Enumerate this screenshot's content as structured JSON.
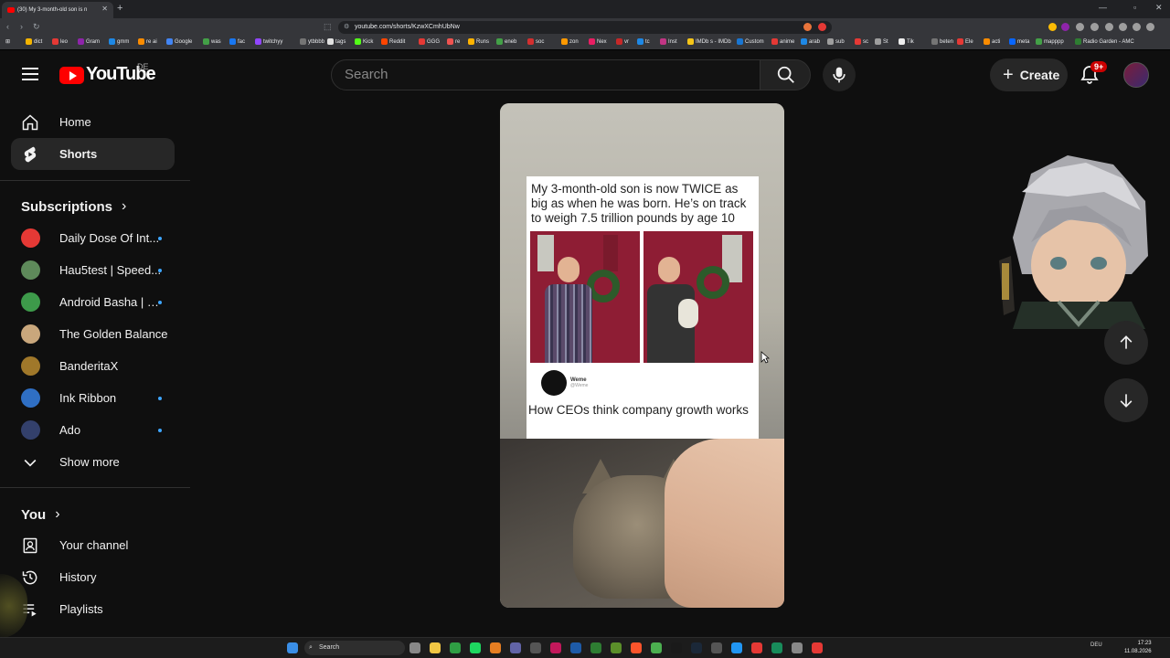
{
  "browser": {
    "tab_title": "(30) My 3-month-old son is n",
    "url": "youtube.com/shorts/KzwXCmhUbNw",
    "bookmarks": [
      "dict",
      "leo",
      "Gram",
      "gmm",
      "re ai",
      "Google",
      "was",
      "fac",
      "twitchyy",
      "ytbbbb",
      "tags",
      "Kick",
      "Reddit",
      "GGG",
      "re",
      "Runs",
      "eneb",
      "soc",
      "zon",
      "Nex",
      "vr",
      "tc",
      "Inst",
      "IMDb s - IMDb",
      "Custom",
      "anime",
      "arab",
      "sub",
      "sc",
      "St",
      "Tik",
      "beten",
      "Ele",
      "acti",
      "meta",
      "mapppp",
      "Radio Garden - AMC"
    ],
    "bookmark_colors": [
      "#f4b400",
      "#e53935",
      "#8e24aa",
      "#1e88e5",
      "#fb8c00",
      "#4285f4",
      "#43a047",
      "#1877f2",
      "#9146ff",
      "#757575",
      "#e0e0e0",
      "#53fc18",
      "#ff4500",
      "#e53935",
      "#ef5350",
      "#ffb300",
      "#43a047",
      "#d32f2f",
      "#ff9900",
      "#e91e63",
      "#c62828",
      "#1e88e5",
      "#c13584",
      "#f5c518",
      "#1976d2",
      "#e53935",
      "#1e88e5",
      "#9e9e9e",
      "#e53935",
      "#9e9e9e",
      "#eeeeee",
      "#757575",
      "#e53935",
      "#fb8c00",
      "#0866ff",
      "#43a047",
      "#2e7d32"
    ]
  },
  "header": {
    "logo_text": "YouTube",
    "country_code": "DE",
    "search_placeholder": "Search",
    "create_label": "Create",
    "notification_count": "9+"
  },
  "sidebar": {
    "main": [
      {
        "label": "Home",
        "icon": "home-icon"
      },
      {
        "label": "Shorts",
        "icon": "shorts-icon"
      }
    ],
    "subscriptions_heading": "Subscriptions",
    "subscriptions": [
      {
        "label": "Daily Dose Of Int...",
        "color": "#e53935",
        "new": true
      },
      {
        "label": "Hau5test | Speed...",
        "color": "#5e8a5a",
        "new": true
      },
      {
        "label": "Android Basha | …",
        "color": "#3d9a4a",
        "new": true
      },
      {
        "label": "The Golden Balance",
        "color": "#c9a77c",
        "new": false
      },
      {
        "label": "BanderitaX",
        "color": "#a0782a",
        "new": false
      },
      {
        "label": "Ink Ribbon",
        "color": "#2f6fc4",
        "new": true
      },
      {
        "label": "Ado",
        "color": "#33406b",
        "new": true
      }
    ],
    "show_more_label": "Show more",
    "you_heading": "You",
    "you_items": [
      {
        "label": "Your channel",
        "icon": "channel-icon"
      },
      {
        "label": "History",
        "icon": "history-icon"
      },
      {
        "label": "Playlists",
        "icon": "playlists-icon"
      }
    ]
  },
  "short": {
    "meme_text": "My 3-month-old son is now TWICE as big as when he was born. He’s on track to weigh 7.5 trillion pounds by age 10",
    "tweet_name": "Weme",
    "tweet_handle": "@Weme",
    "caption": "How CEOs think company growth works"
  },
  "taskbar": {
    "search_label": "Search",
    "language": "DEU",
    "time": "17:23",
    "date": "11.08.2026"
  }
}
